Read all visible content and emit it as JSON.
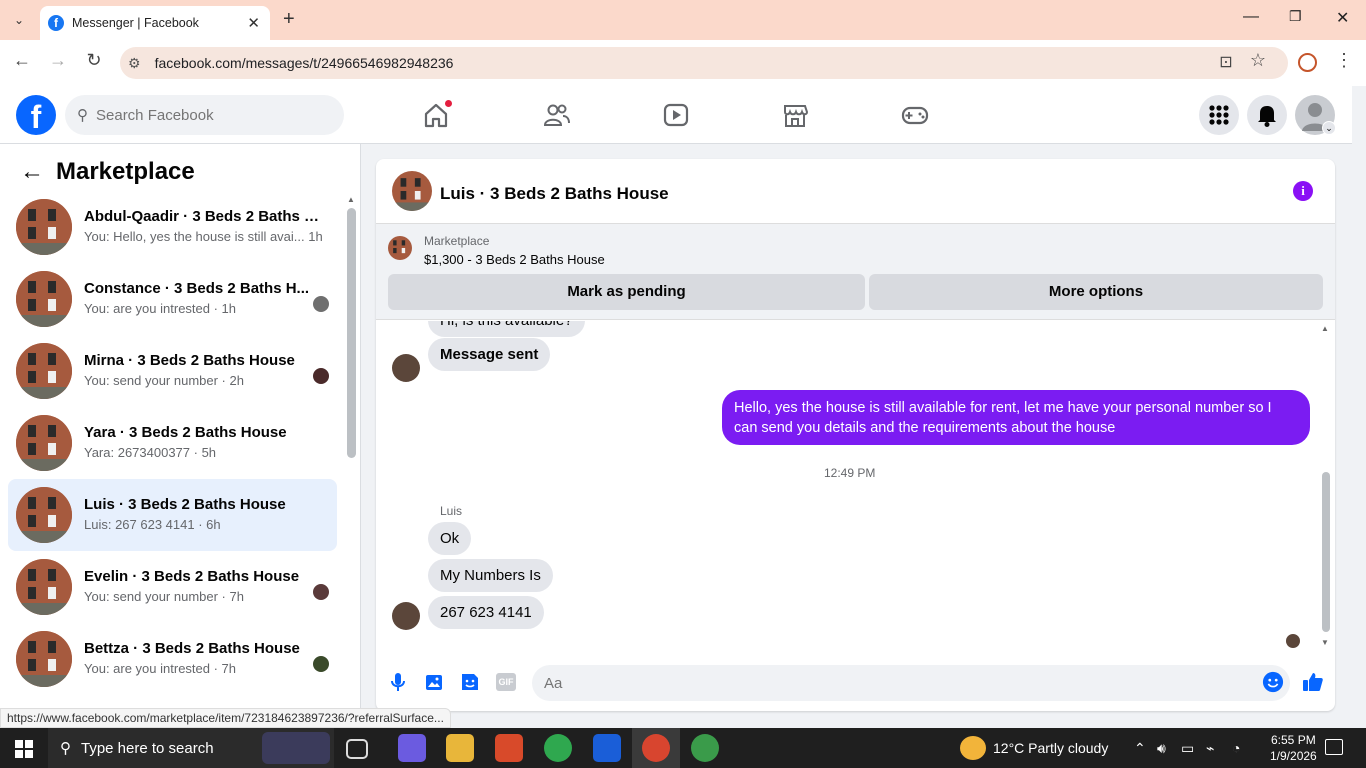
{
  "browser": {
    "tab_title": "Messenger | Facebook",
    "url": "facebook.com/messages/t/24966546982948236",
    "status_url": "https://www.facebook.com/marketplace/item/723184623897236/?referralSurface..."
  },
  "fb": {
    "search_placeholder": "Search Facebook",
    "colors": {
      "brand": "#0866ff",
      "accent": "#7b1cf2",
      "selected": "#e7f0fd"
    }
  },
  "sidebar": {
    "title": "Marketplace",
    "conversations": [
      {
        "name": "Abdul-Qaadir · 3 Beds 2 Baths H...",
        "preview": "You: Hello, yes the house is still avai... 1h"
      },
      {
        "name": "Constance · 3 Beds 2 Baths H...",
        "preview": "You: are you intrested · 1h"
      },
      {
        "name": "Mirna · 3 Beds 2 Baths House",
        "preview": "You: send your number · 2h"
      },
      {
        "name": "Yara · 3 Beds 2 Baths House",
        "preview": "Yara: 2673400377 · 5h"
      },
      {
        "name": "Luis · 3 Beds 2 Baths House",
        "preview": "Luis: 267 623 4141 · 6h"
      },
      {
        "name": "Evelin · 3 Beds 2 Baths House",
        "preview": "You: send your number · 7h"
      },
      {
        "name": "Bettza · 3 Beds 2 Baths House",
        "preview": "You: are you intrested · 7h"
      }
    ]
  },
  "chat": {
    "title": "Luis · 3 Beds 2 Baths House",
    "marketplace_label": "Marketplace",
    "listing": "$1,300 - 3 Beds 2 Baths House",
    "mark_pending": "Mark as pending",
    "more_options": "More options",
    "msg_partial": "Hi, is this available?",
    "msg_sent": "Message sent",
    "my_reply": "Hello, yes the house is still available for rent, let me have your personal number so I can send you details and the requirements about the house",
    "timestamp": "12:49 PM",
    "sender": "Luis",
    "msgs": [
      "Ok",
      "My Numbers Is",
      "267 623 4141"
    ],
    "input_placeholder": "Aa"
  },
  "taskbar": {
    "search": "Type here to search",
    "weather": "12°C  Partly cloudy",
    "time": "6:55 PM",
    "date": "1/9/2026"
  }
}
